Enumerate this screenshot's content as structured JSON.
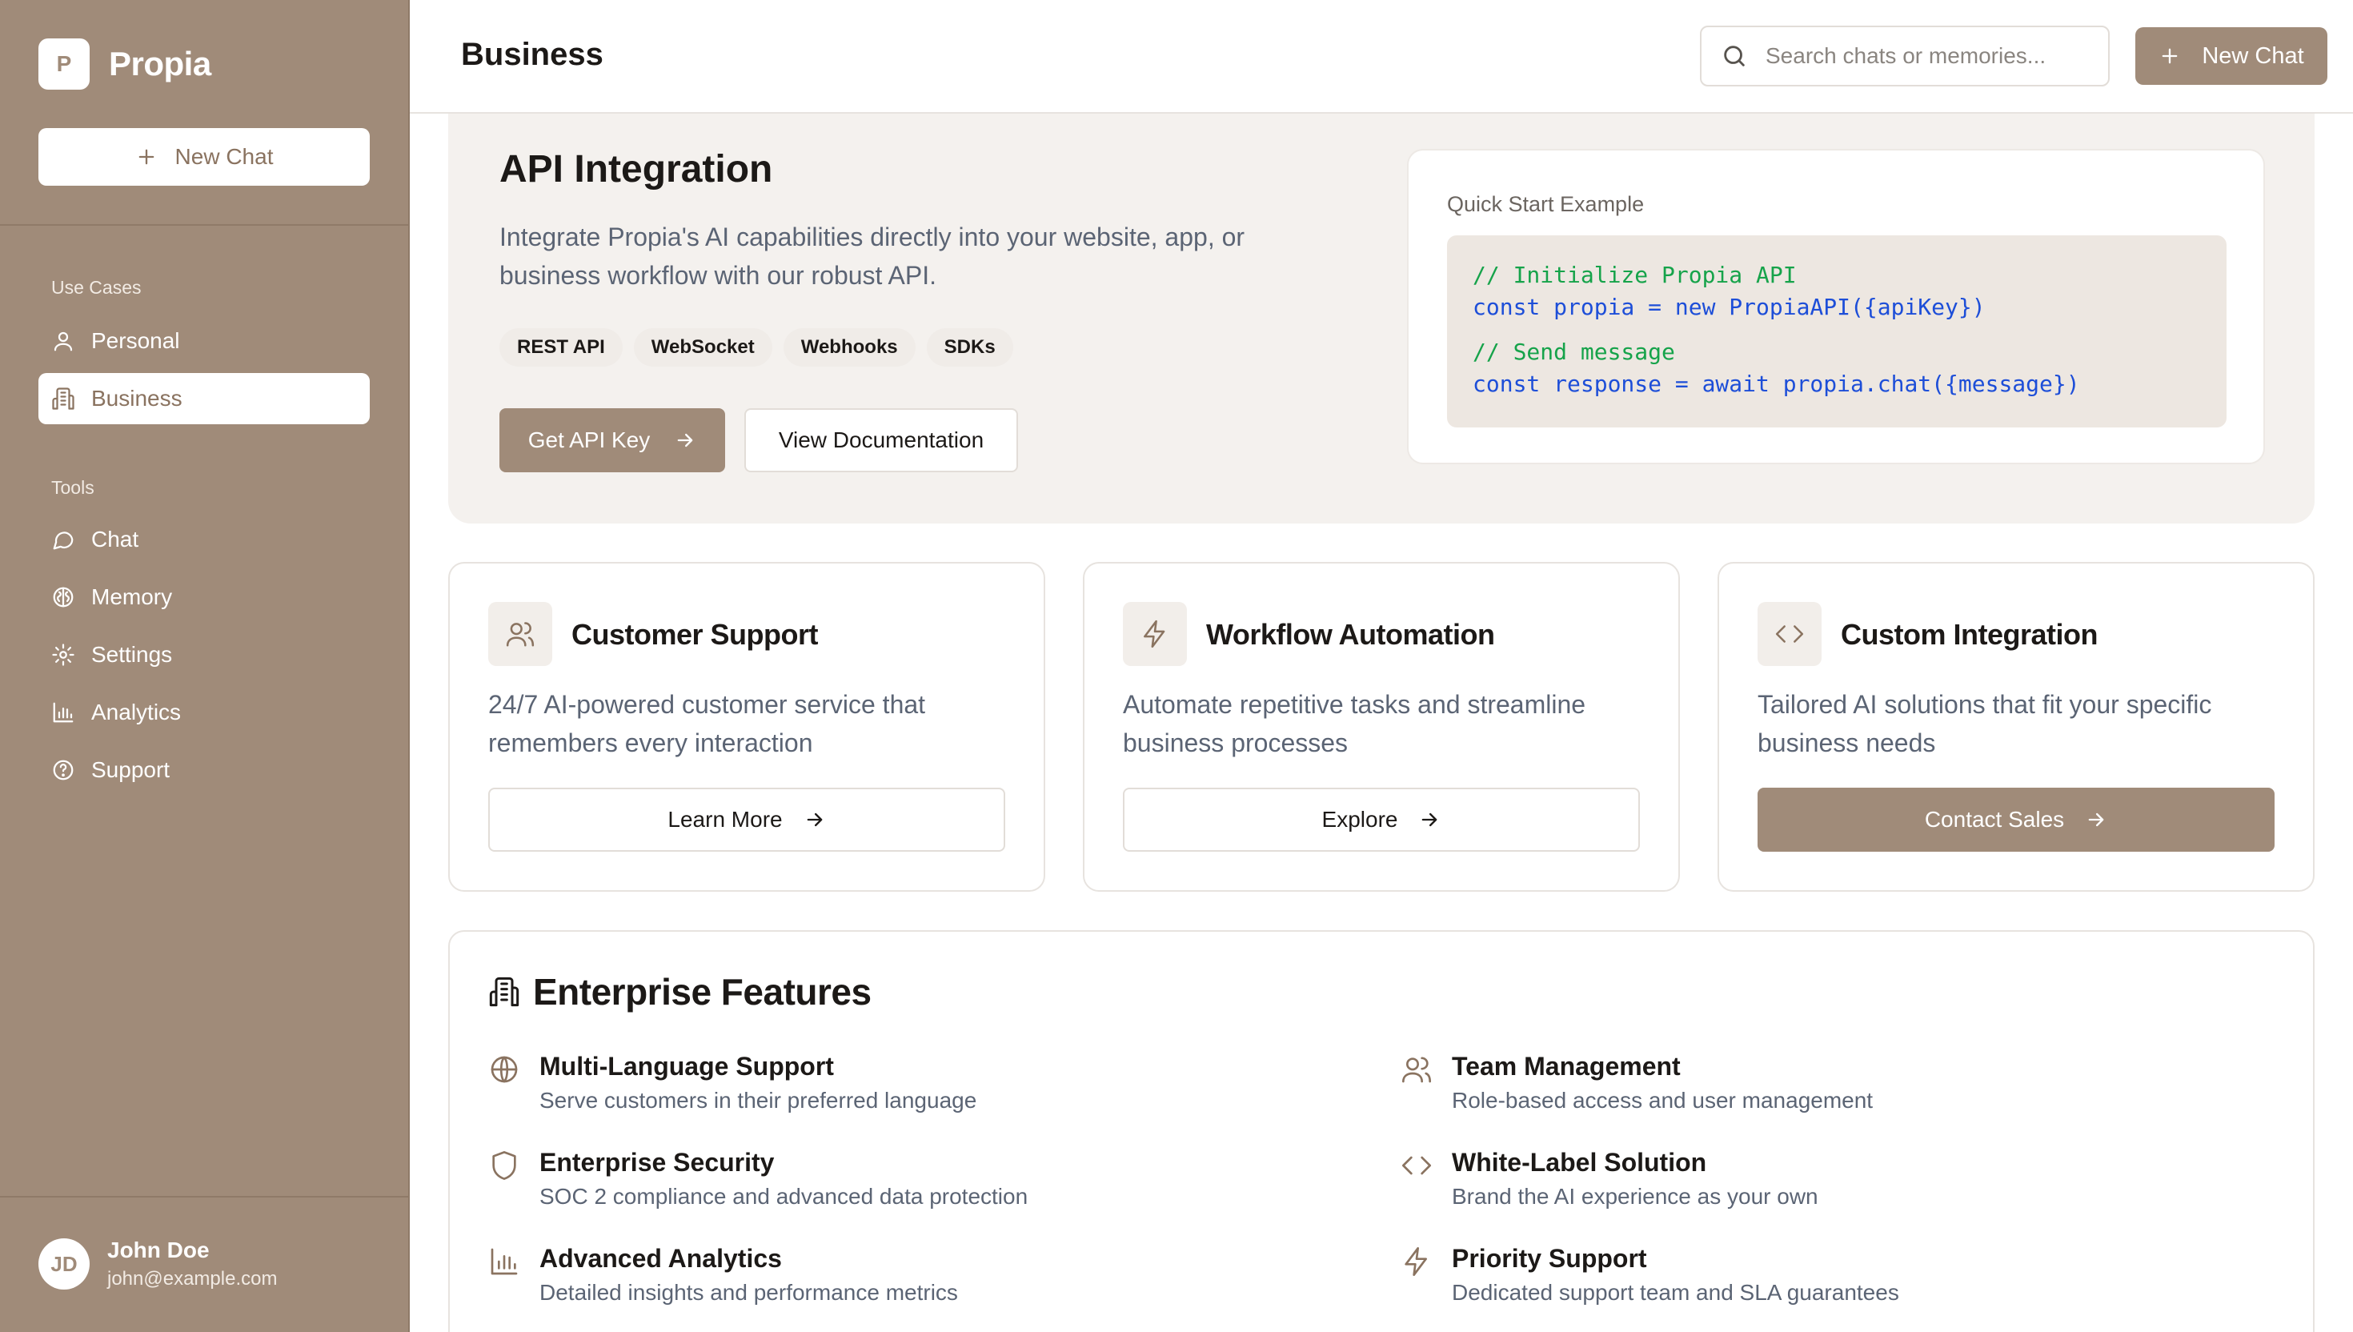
{
  "sidebar": {
    "logo_letter": "P",
    "brand": "Propia",
    "new_chat": "New Chat",
    "use_cases_label": "Use Cases",
    "use_cases": [
      {
        "label": "Personal",
        "icon": "user-icon"
      },
      {
        "label": "Business",
        "icon": "building-icon",
        "active": true
      }
    ],
    "tools_label": "Tools",
    "tools": [
      {
        "label": "Chat",
        "icon": "chat-icon"
      },
      {
        "label": "Memory",
        "icon": "brain-icon"
      },
      {
        "label": "Settings",
        "icon": "gear-icon"
      },
      {
        "label": "Analytics",
        "icon": "bar-chart-icon"
      },
      {
        "label": "Support",
        "icon": "help-icon"
      }
    ],
    "user": {
      "initials": "JD",
      "name": "John Doe",
      "email": "john@example.com"
    }
  },
  "header": {
    "title": "Business",
    "search_placeholder": "Search chats or memories...",
    "new_chat": "New Chat"
  },
  "api": {
    "title": "API Integration",
    "description": "Integrate Propia's AI capabilities directly into your website, app, or business workflow with our robust API.",
    "tags": [
      "REST API",
      "WebSocket",
      "Webhooks",
      "SDKs"
    ],
    "primary_button": "Get API Key",
    "secondary_button": "View Documentation",
    "code_label": "Quick Start Example",
    "code": {
      "comment1": "// Initialize Propia API",
      "line1": "const propia = new PropiaAPI({apiKey})",
      "comment2": "// Send message",
      "line2": "const response = await propia.chat({message})"
    }
  },
  "cards": [
    {
      "title": "Customer Support",
      "description": "24/7 AI-powered customer service that remembers every interaction",
      "button": "Learn More",
      "icon": "users-icon"
    },
    {
      "title": "Workflow Automation",
      "description": "Automate repetitive tasks and streamline business processes",
      "button": "Explore",
      "icon": "lightning-icon"
    },
    {
      "title": "Custom Integration",
      "description": "Tailored AI solutions that fit your specific business needs",
      "button": "Contact Sales",
      "icon": "code-icon"
    }
  ],
  "enterprise": {
    "title": "Enterprise Features",
    "features": [
      {
        "title": "Multi-Language Support",
        "description": "Serve customers in their preferred language",
        "icon": "globe-icon"
      },
      {
        "title": "Team Management",
        "description": "Role-based access and user management",
        "icon": "users-icon"
      },
      {
        "title": "Enterprise Security",
        "description": "SOC 2 compliance and advanced data protection",
        "icon": "shield-icon"
      },
      {
        "title": "White-Label Solution",
        "description": "Brand the AI experience as your own",
        "icon": "code-icon"
      },
      {
        "title": "Advanced Analytics",
        "description": "Detailed insights and performance metrics",
        "icon": "bar-chart-icon"
      },
      {
        "title": "Priority Support",
        "description": "Dedicated support team and SLA guarantees",
        "icon": "lightning-icon"
      }
    ]
  },
  "colors": {
    "brand": "#a08b79",
    "sidebar": "#a08b79",
    "panel": "#f4f1ee",
    "code_comment": "#16a34a",
    "code_text": "#1d4ed8"
  }
}
